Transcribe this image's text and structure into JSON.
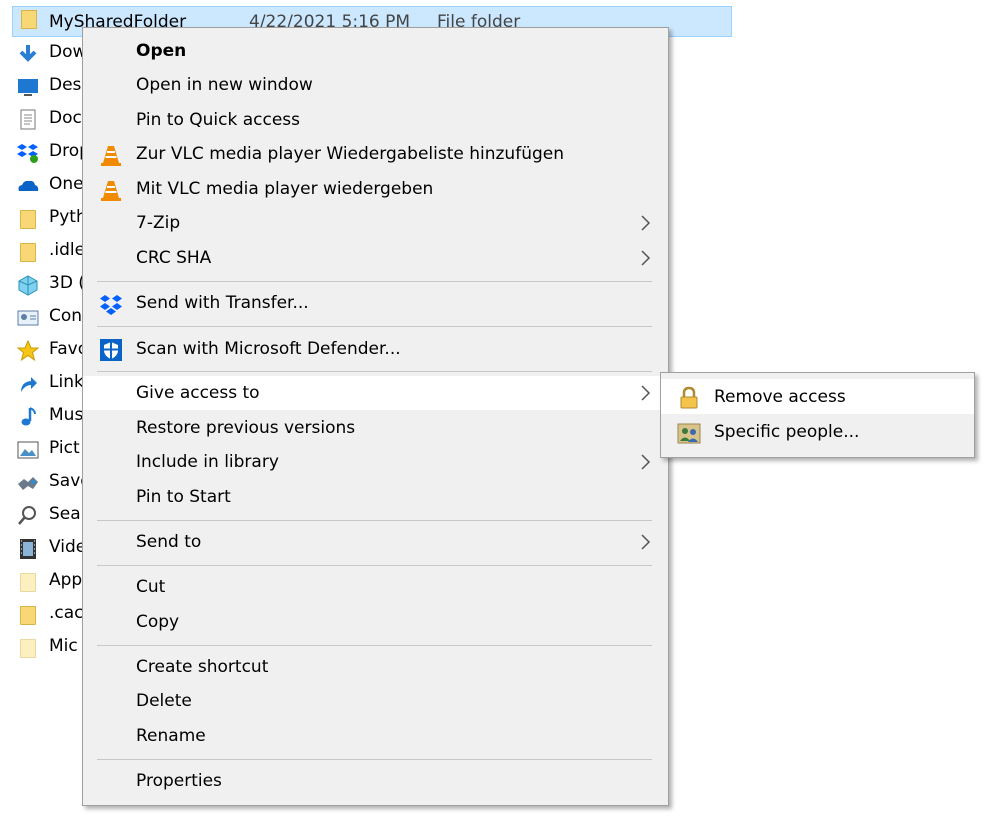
{
  "file_list": {
    "selected": {
      "name": "MySharedFolder",
      "date": "4/22/2021 5:16 PM",
      "type": "File folder"
    },
    "items": [
      {
        "name": "Dow",
        "icon": "download-arrow-icon"
      },
      {
        "name": "Desl",
        "icon": "desktop-icon"
      },
      {
        "name": "Doc",
        "icon": "document-icon"
      },
      {
        "name": "Drop",
        "icon": "dropbox-icon"
      },
      {
        "name": "One",
        "icon": "onedrive-cloud-icon"
      },
      {
        "name": "Pyth",
        "icon": "folder-icon"
      },
      {
        "name": ".idle",
        "icon": "folder-icon"
      },
      {
        "name": "3D (",
        "icon": "3d-objects-icon"
      },
      {
        "name": "Con",
        "icon": "contacts-icon"
      },
      {
        "name": "Favo",
        "icon": "star-icon"
      },
      {
        "name": "Link",
        "icon": "link-arrow-icon"
      },
      {
        "name": "Mus",
        "icon": "music-note-icon"
      },
      {
        "name": "Pict",
        "icon": "pictures-icon"
      },
      {
        "name": "Save",
        "icon": "saved-games-icon"
      },
      {
        "name": "Sear",
        "icon": "search-icon"
      },
      {
        "name": "Vide",
        "icon": "video-icon"
      },
      {
        "name": "App",
        "icon": "folder-pale-icon"
      },
      {
        "name": ".cac",
        "icon": "folder-icon"
      },
      {
        "name": "Mic",
        "icon": "folder-pale-icon"
      }
    ]
  },
  "context_menu": {
    "open": "Open",
    "open_new_window": "Open in new window",
    "pin_quick_access": "Pin to Quick access",
    "vlc_playlist": "Zur VLC media player Wiedergabeliste hinzufügen",
    "vlc_play": "Mit VLC media player wiedergeben",
    "seven_zip": "7-Zip",
    "crc_sha": "CRC SHA",
    "send_transfer": "Send with Transfer...",
    "scan_defender": "Scan with Microsoft Defender...",
    "give_access": "Give access to",
    "restore_versions": "Restore previous versions",
    "include_library": "Include in library",
    "pin_start": "Pin to Start",
    "send_to": "Send to",
    "cut": "Cut",
    "copy": "Copy",
    "create_shortcut": "Create shortcut",
    "delete": "Delete",
    "rename": "Rename",
    "properties": "Properties"
  },
  "submenu": {
    "remove_access": "Remove access",
    "specific_people": "Specific people..."
  },
  "colors": {
    "selection": "#cce8ff",
    "menu_bg": "#f0f0f0",
    "hover": "#ffffff",
    "vlc_orange": "#f08a00",
    "dropbox_blue": "#0061fe",
    "defender_blue": "#0a64c8"
  }
}
